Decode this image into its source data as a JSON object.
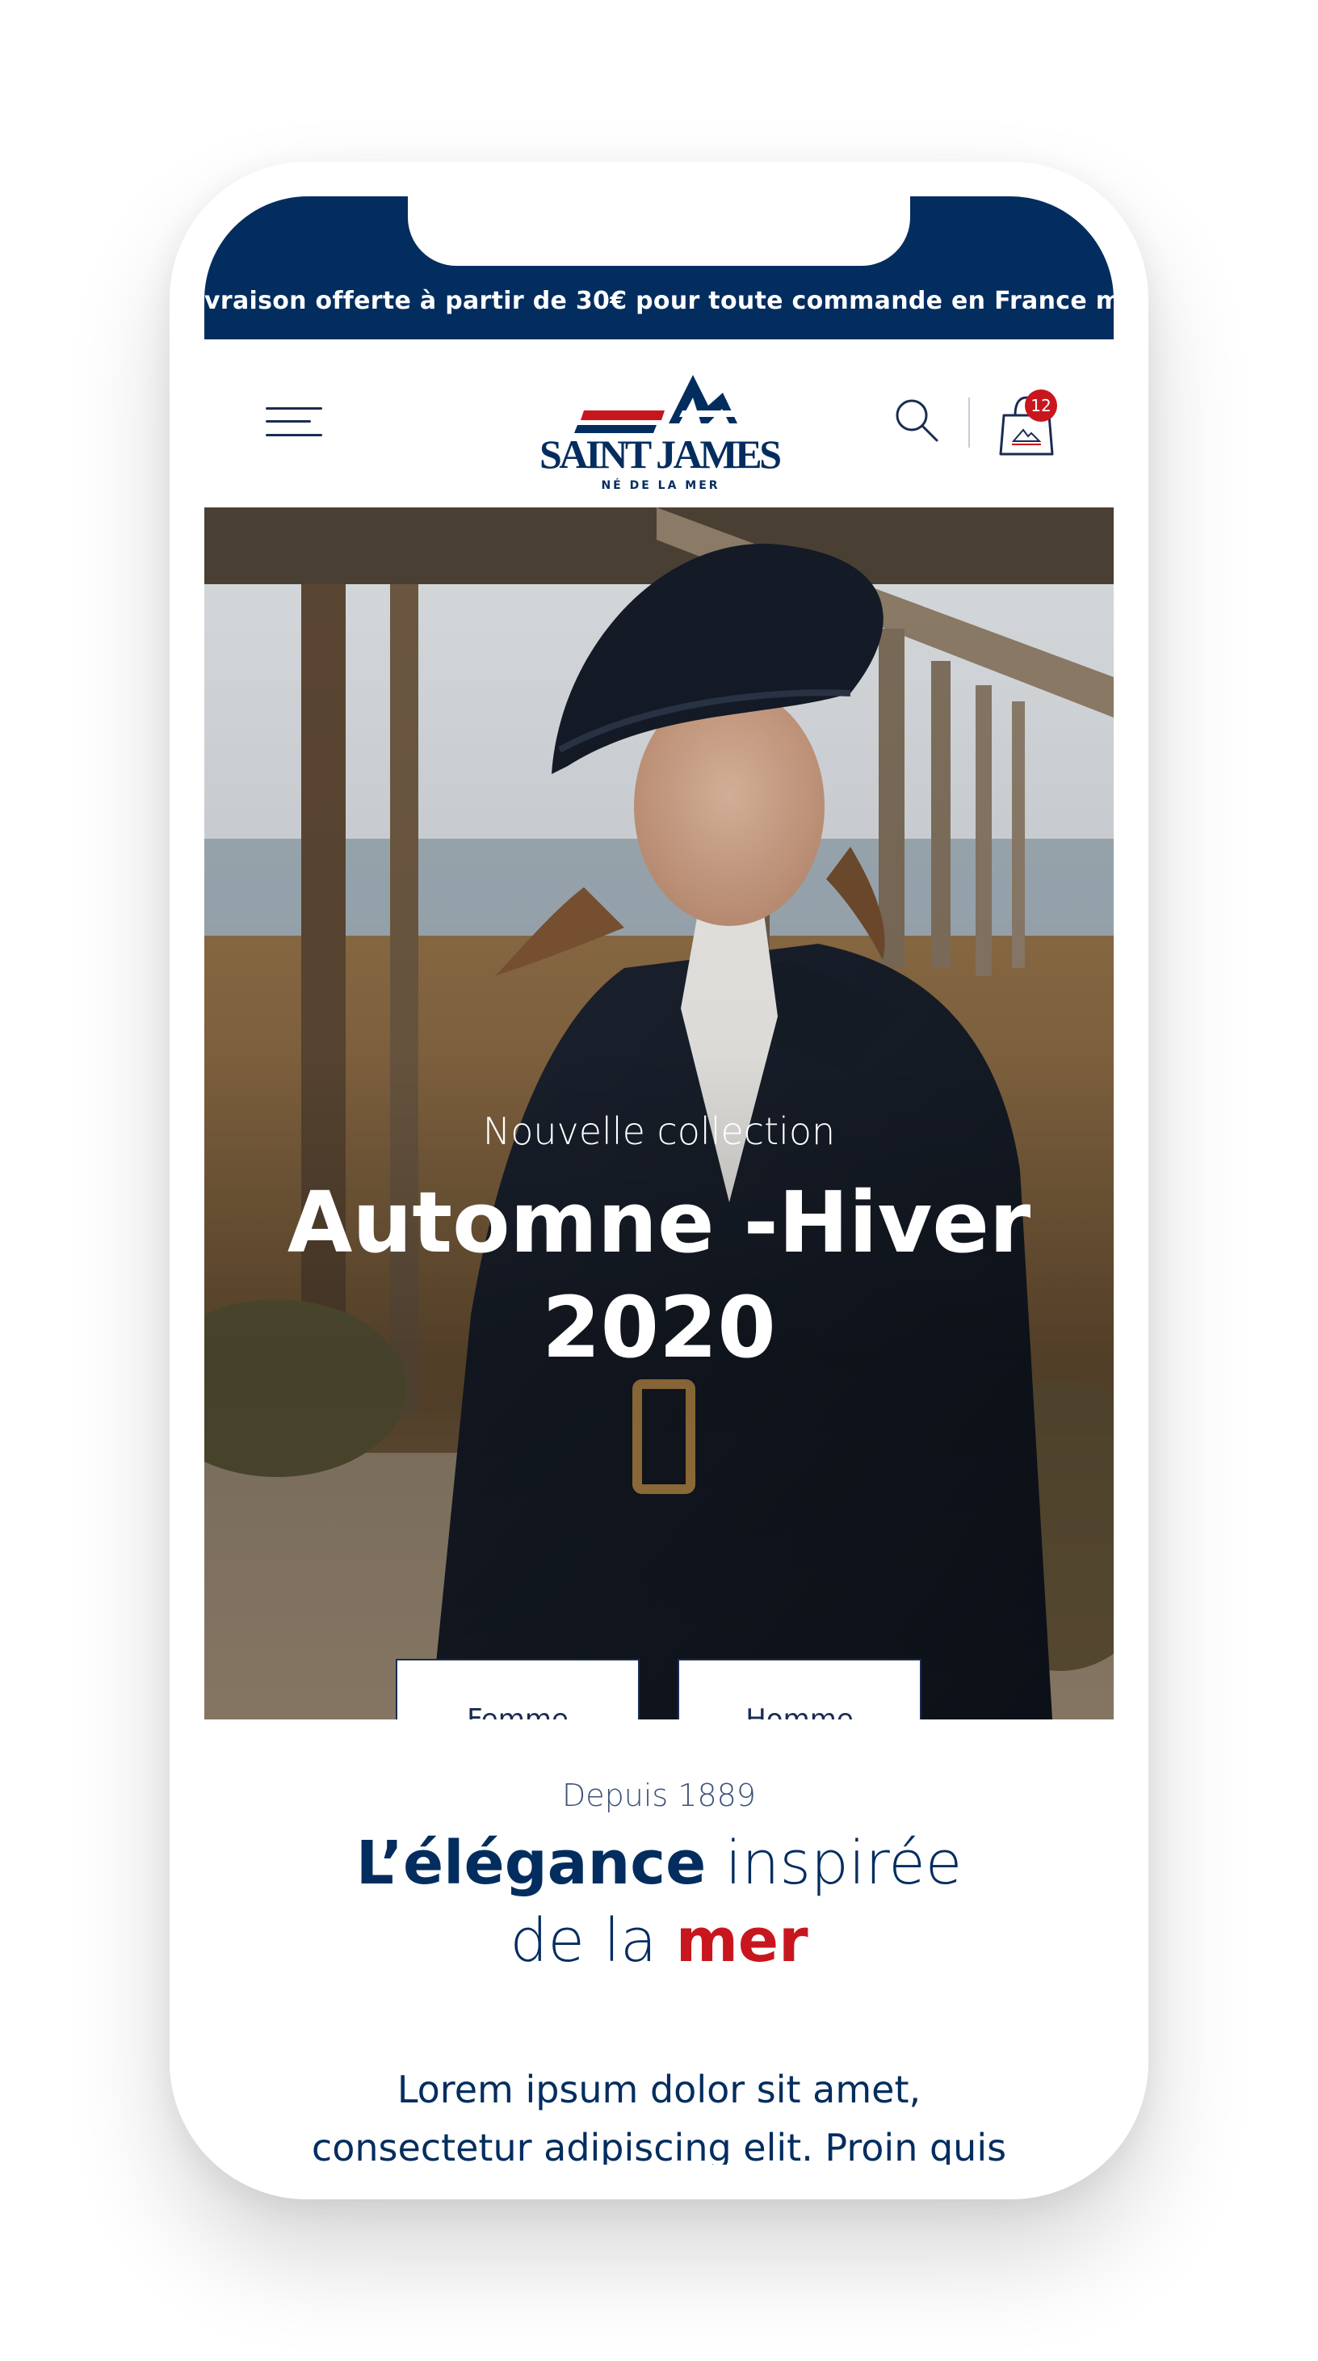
{
  "banner": {
    "text": "vraison offerte à partir de 30€ pour toute commande en France métropolitaine"
  },
  "header": {
    "logo_text": "SAINT JAMES",
    "logo_tagline": "NÉ DE LA MER",
    "cart_count": "12"
  },
  "hero": {
    "eyebrow": "Nouvelle collection",
    "title_line1": "Automne -Hiver",
    "title_line2": "2020",
    "buttons": [
      "Femme",
      "Homme"
    ]
  },
  "intro": {
    "since": "Depuis 1889",
    "tagline_part1": "L’élégance",
    "tagline_part2": "inspirée",
    "tagline_part3": "de la",
    "tagline_part4": "mer",
    "body": "Lorem ipsum dolor sit amet, consectetur adipiscing elit. Proin quis venenatis nulla."
  },
  "colors": {
    "navy": "#032d5f",
    "red": "#c8161e",
    "white": "#ffffff"
  },
  "icons": [
    "hamburger-menu-icon",
    "search-icon",
    "shopping-bag-icon"
  ]
}
